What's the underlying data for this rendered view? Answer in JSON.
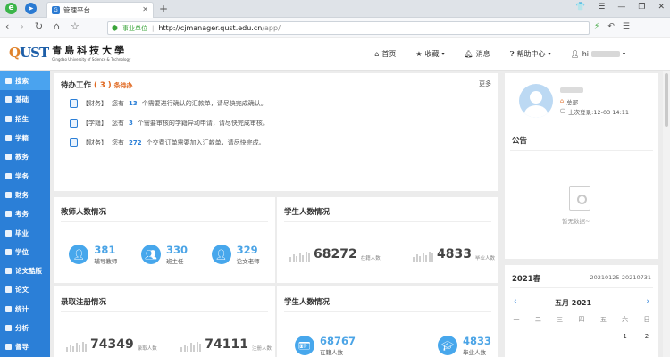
{
  "browser": {
    "tab_title": "管理平台",
    "safe_label": "事业单位",
    "url_host": "http://cjmanager.qust.edu.cn",
    "url_path": "/app/"
  },
  "logo": {
    "mark_q": "Q",
    "mark_ust": "UST",
    "name_cn": "青島科技大學",
    "name_en": "Qingdao University of Science & Technology"
  },
  "topnav": {
    "home": "首页",
    "favorites": "收藏",
    "messages": "消息",
    "help": "帮助中心",
    "user_greeting": "hi"
  },
  "sidebar": {
    "items": [
      "搜索",
      "基础",
      "招生",
      "学籍",
      "教务",
      "学务",
      "财务",
      "考务",
      "毕业",
      "学位",
      "论文酷版",
      "论文",
      "统计",
      "分析",
      "督导"
    ]
  },
  "todo": {
    "title": "待办工作",
    "count": "( 3 )",
    "count_label": "条待办",
    "more": "更多",
    "items": [
      {
        "tag": "【财务】",
        "pre": "您有",
        "num": "13",
        "post": "个需要进行确认的汇款单，请尽快完成确认。"
      },
      {
        "tag": "【学籍】",
        "pre": "您有",
        "num": "3",
        "post": "个需要审核的学籍异动申请，请尽快完成审核。"
      },
      {
        "tag": "【财务】",
        "pre": "您有",
        "num": "272",
        "post": "个交费订单需要加入汇款单，请尽快完成。"
      }
    ]
  },
  "teacher": {
    "title": "教师人数情况",
    "stats": [
      {
        "num": "381",
        "label": "辅导教师"
      },
      {
        "num": "330",
        "label": "班主任"
      },
      {
        "num": "329",
        "label": "论文老师"
      }
    ]
  },
  "student1": {
    "title": "学生人数情况",
    "stats": [
      {
        "num": "68272",
        "label": "在籍人数"
      },
      {
        "num": "4833",
        "label": "毕业人数"
      }
    ]
  },
  "admission": {
    "title": "录取注册情况",
    "stats": [
      {
        "num": "74349",
        "label": "录取人数"
      },
      {
        "num": "74111",
        "label": "注册人数"
      }
    ]
  },
  "student2": {
    "title": "学生人数情况",
    "stats": [
      {
        "num": "68767",
        "label": "在籍人数"
      },
      {
        "num": "4833",
        "label": "毕业人数"
      }
    ]
  },
  "profile": {
    "role": "总部",
    "last_login": "上次登录:12-03 14:11"
  },
  "notice": {
    "title": "公告",
    "empty": "暂无数据~"
  },
  "term": {
    "title": "2021春",
    "range": "20210125-20210731",
    "month": "五月 2021",
    "weekdays": [
      "一",
      "二",
      "三",
      "四",
      "五",
      "六",
      "日"
    ],
    "days": [
      "1",
      "2"
    ]
  },
  "icons": {
    "brand": "#2b7fd7",
    "accent": "#4ba4e6",
    "badge": "#e06820"
  }
}
